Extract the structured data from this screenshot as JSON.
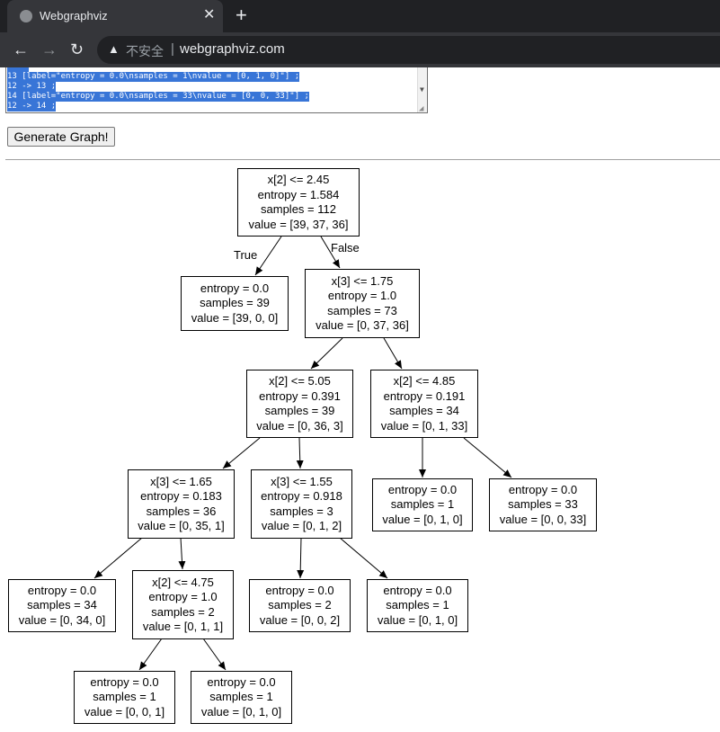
{
  "browser": {
    "tab_title": "Webgraphviz",
    "tab_close": "✕",
    "new_tab": "+",
    "back": "←",
    "forward": "→",
    "reload": "↻",
    "security_icon": "▲",
    "security_text": "不安全",
    "separator": "|",
    "url": "webgraphviz.com"
  },
  "editor": {
    "lines": [
      "13 [label=\"entropy = 0.0\\nsamples = 1\\nvalue = [0, 1, 0]\"] ;",
      "12 -> 13 ;",
      "14 [label=\"entropy = 0.0\\nsamples = 33\\nvalue = [0, 0, 33]\"] ;",
      "12 -> 14 ;"
    ]
  },
  "generate_button": "Generate Graph!",
  "tree": {
    "n0": {
      "l1": "x[2] <= 2.45",
      "l2": "entropy = 1.584",
      "l3": "samples = 112",
      "l4": "value = [39, 37, 36]"
    },
    "n1": {
      "l1": "entropy = 0.0",
      "l2": "samples = 39",
      "l3": "value = [39, 0, 0]"
    },
    "n2": {
      "l1": "x[3] <= 1.75",
      "l2": "entropy = 1.0",
      "l3": "samples = 73",
      "l4": "value = [0, 37, 36]"
    },
    "n3": {
      "l1": "x[2] <= 5.05",
      "l2": "entropy = 0.391",
      "l3": "samples = 39",
      "l4": "value = [0, 36, 3]"
    },
    "n4": {
      "l1": "x[2] <= 4.85",
      "l2": "entropy = 0.191",
      "l3": "samples = 34",
      "l4": "value = [0, 1, 33]"
    },
    "n5": {
      "l1": "x[3] <= 1.65",
      "l2": "entropy = 0.183",
      "l3": "samples = 36",
      "l4": "value = [0, 35, 1]"
    },
    "n6": {
      "l1": "x[3] <= 1.55",
      "l2": "entropy = 0.918",
      "l3": "samples = 3",
      "l4": "value = [0, 1, 2]"
    },
    "n7": {
      "l1": "entropy = 0.0",
      "l2": "samples = 1",
      "l3": "value = [0, 1, 0]"
    },
    "n8": {
      "l1": "entropy = 0.0",
      "l2": "samples = 33",
      "l3": "value = [0, 0, 33]"
    },
    "n9": {
      "l1": "entropy = 0.0",
      "l2": "samples = 34",
      "l3": "value = [0, 34, 0]"
    },
    "n10": {
      "l1": "x[2] <= 4.75",
      "l2": "entropy = 1.0",
      "l3": "samples = 2",
      "l4": "value = [0, 1, 1]"
    },
    "n11": {
      "l1": "entropy = 0.0",
      "l2": "samples = 2",
      "l3": "value = [0, 0, 2]"
    },
    "n12": {
      "l1": "entropy = 0.0",
      "l2": "samples = 1",
      "l3": "value = [0, 1, 0]"
    },
    "n13": {
      "l1": "entropy = 0.0",
      "l2": "samples = 1",
      "l3": "value = [0, 0, 1]"
    },
    "n14": {
      "l1": "entropy = 0.0",
      "l2": "samples = 1",
      "l3": "value = [0, 1, 0]"
    },
    "true_label": "True",
    "false_label": "False"
  }
}
